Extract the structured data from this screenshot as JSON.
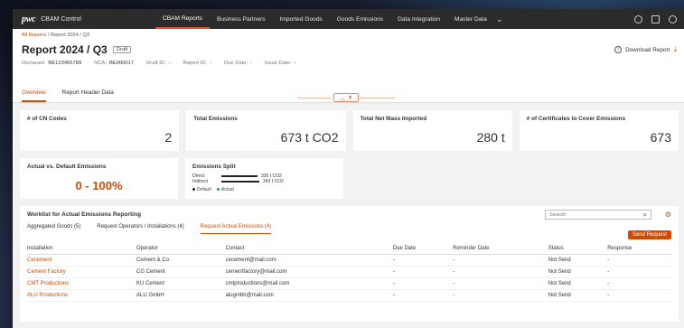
{
  "app": {
    "brand_logo": "pwc",
    "brand_name": "CBAM Control"
  },
  "nav": {
    "items": [
      "CBAM Reports",
      "Business Partners",
      "Imported Goods",
      "Goods Emissions",
      "Data Integration",
      "Master Data"
    ],
    "active": "CBAM Reports"
  },
  "breadcrumb": {
    "root": "All Reports",
    "separator": " / ",
    "current": "Report 2024 / Q3"
  },
  "report": {
    "title": "Report 2024 / Q3",
    "status": "Draft",
    "download_label": "Download Report",
    "meta": [
      {
        "label": "Declarant:",
        "value": "BE123456789"
      },
      {
        "label": "NCA:",
        "value": "BE000017"
      },
      {
        "label": "Draft ID:",
        "value": "-"
      },
      {
        "label": "Report ID:",
        "value": "-"
      },
      {
        "label": "Due Date:",
        "value": "-"
      },
      {
        "label": "Issue Date:",
        "value": "-"
      }
    ],
    "tabs": [
      "Overview",
      "Report Header Data"
    ]
  },
  "cards": [
    {
      "label": "# of CN Codes",
      "value": "2"
    },
    {
      "label": "Total Emissions",
      "value": "673 t CO2"
    },
    {
      "label": "Total Net Mass Imported",
      "value": "280 t"
    },
    {
      "label": "# of Certificates to Cover Emissions",
      "value": "673"
    }
  ],
  "actual_vs_default": {
    "label": "Actual vs. Default Emissions",
    "value": "0 - 100%"
  },
  "emissions_split": {
    "label": "Emissions Split",
    "rows": [
      {
        "name": "Direct",
        "value": "330 t CO2"
      },
      {
        "name": "Indirect",
        "value": "343 t CO2"
      }
    ],
    "legend": [
      {
        "name": "Default",
        "color": "#222222"
      },
      {
        "name": "Actual",
        "color": "#2e9b5a"
      }
    ]
  },
  "worklist": {
    "title": "Worklist for Actual Emissions Reporting",
    "search_placeholder": "Search",
    "tabs": [
      "Aggregated Goods (5)",
      "Request Operators / Installations (4)",
      "Request Actual Emissions (4)"
    ],
    "active_tab": "Request Actual Emissions (4)",
    "send_label": "Send Request",
    "columns": [
      "Installation",
      "Operator",
      "Contact",
      "Due Date",
      "Reminder Date",
      "Status",
      "Response"
    ],
    "rows": [
      [
        "Cecement",
        "Cement & Co.",
        "cecement@mail.com",
        "-",
        "-",
        "Not Send",
        "-"
      ],
      [
        "Cement Factory",
        "CG Cement",
        "cementfactory@mail.com",
        "-",
        "-",
        "Not Send",
        "-"
      ],
      [
        "CMT Productions",
        "KU Cement",
        "cmtproductions@mail.com",
        "-",
        "-",
        "Not Send",
        "-"
      ],
      [
        "ALU Productions",
        "ALU GmbH",
        "alugmbh@mail.com",
        "-",
        "-",
        "Not Send",
        "-"
      ]
    ]
  },
  "colors": {
    "accent": "#d04a02",
    "nav_bg": "#2b2b2b"
  }
}
